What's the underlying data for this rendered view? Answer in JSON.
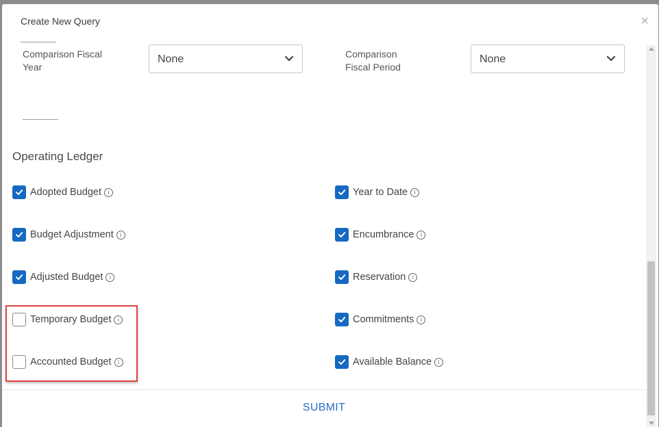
{
  "modal": {
    "title": "Create New Query",
    "close_label": "×"
  },
  "fields": {
    "comparison_fiscal_year": {
      "label_line1": "Comparison Fiscal",
      "label_line2": "Year",
      "value": "None"
    },
    "comparison_fiscal_period": {
      "label_line1": "Comparison",
      "label_line2": "Fiscal Period",
      "value": "None"
    }
  },
  "operating_ledger": {
    "title": "Operating Ledger",
    "left": [
      {
        "label": "Adopted Budget",
        "checked": true
      },
      {
        "label": "Budget Adjustment",
        "checked": true
      },
      {
        "label": "Adjusted Budget",
        "checked": true
      },
      {
        "label": "Temporary Budget",
        "checked": false
      },
      {
        "label": "Accounted Budget",
        "checked": false
      }
    ],
    "right": [
      {
        "label": "Year to Date",
        "checked": true
      },
      {
        "label": "Encumbrance",
        "checked": true
      },
      {
        "label": "Reservation",
        "checked": true
      },
      {
        "label": "Commitments",
        "checked": true
      },
      {
        "label": "Available Balance",
        "checked": true
      }
    ],
    "info_glyph": "i"
  },
  "footer": {
    "submit_label": "SUBMIT"
  },
  "colors": {
    "accent": "#1669c0",
    "highlight": "#e0433f",
    "submit_text": "#2a6fc9"
  }
}
